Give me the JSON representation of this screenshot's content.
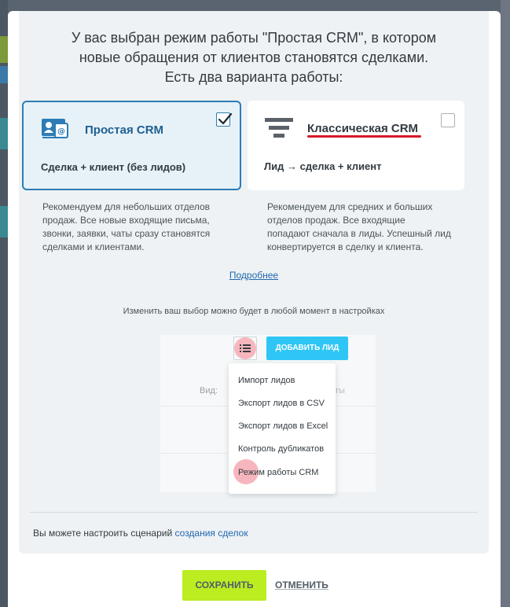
{
  "headline": {
    "line1": "У вас выбран режим работы \"Простая CRM\", в котором",
    "line2": "новые обращения от клиентов становятся сделками.",
    "line3": "Есть два варианта работы:"
  },
  "options": [
    {
      "title": "Простая CRM",
      "subtitle": "Сделка + клиент (без лидов)",
      "checked": true,
      "icon": "contact-card-icon",
      "description": [
        "Рекомендуем для небольших отделов",
        "продаж. Все новые входящие письма,",
        "звонки, заявки, чаты сразу становятся",
        "сделками и клиентами."
      ]
    },
    {
      "title": "Классическая CRM",
      "subtitle": "Лид → сделка + клиент",
      "checked": false,
      "icon": "funnel-icon",
      "description": [
        "Рекомендуем для средних и больших",
        "отделов продаж. Все входящие",
        "попадают сначала в лиды. Успешный лид",
        "конвертируется в сделку и клиента."
      ]
    }
  ],
  "more_link": "Подробнее",
  "change_note": "Изменить ваш выбор можно будет в любой момент в настройках",
  "preview": {
    "add_lead_button": "ДОБАВИТЬ ЛИД",
    "view_label": "Вид:",
    "faded_text": "ты",
    "menu_items": [
      "Импорт лидов",
      "Экспорт лидов в CSV",
      "Экспорт лидов в Excel",
      "Контроль дубликатов",
      "Режим работы CRM"
    ]
  },
  "footer": {
    "text": "Вы можете настроить сценарий",
    "link": "создания сделок"
  },
  "buttons": {
    "save": "СОХРАНИТЬ",
    "cancel": "ОТМЕНИТЬ"
  },
  "colors": {
    "accent_blue": "#2d7cb5",
    "save_green": "#bbed21",
    "add_lead_cyan": "#2fc6f6",
    "highlight_red": "#d9172a"
  }
}
